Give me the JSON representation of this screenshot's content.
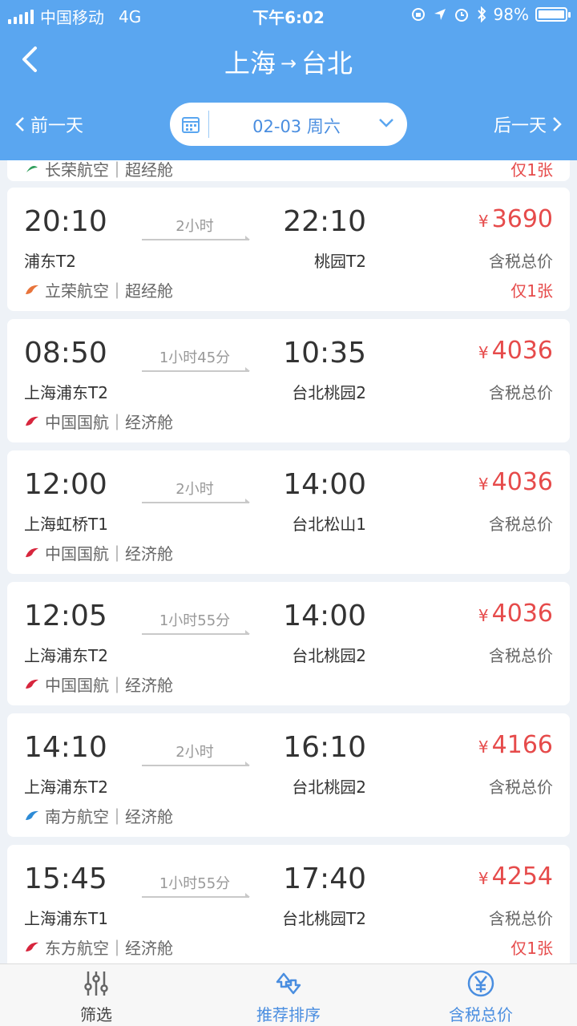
{
  "status_bar": {
    "carrier": "中国移动",
    "network": "4G",
    "time": "下午6:02",
    "battery": "98%"
  },
  "nav": {
    "origin": "上海",
    "arrow": "→",
    "destination": "台北"
  },
  "date_bar": {
    "prev_label": "前一天",
    "next_label": "后一天",
    "date": "02-03 周六"
  },
  "partial_card": {
    "airline": "长荣航空｜超经舱",
    "remaining": "仅1张"
  },
  "flights": [
    {
      "dep_time": "20:10",
      "duration": "2小时",
      "arr_time": "22:10",
      "dep_airport": "浦东T2",
      "arr_airport": "桃园T2",
      "airline": "立荣航空｜超经舱",
      "currency": "¥",
      "price": "3690",
      "price_label": "含税总价",
      "remaining": "仅1张",
      "logo_color": "#e8743b"
    },
    {
      "dep_time": "08:50",
      "duration": "1小时45分",
      "arr_time": "10:35",
      "dep_airport": "上海浦东T2",
      "arr_airport": "台北桃园2",
      "airline": "中国国航｜经济舱",
      "currency": "¥",
      "price": "4036",
      "price_label": "含税总价",
      "remaining": "",
      "logo_color": "#d7263d"
    },
    {
      "dep_time": "12:00",
      "duration": "2小时",
      "arr_time": "14:00",
      "dep_airport": "上海虹桥T1",
      "arr_airport": "台北松山1",
      "airline": "中国国航｜经济舱",
      "currency": "¥",
      "price": "4036",
      "price_label": "含税总价",
      "remaining": "",
      "logo_color": "#d7263d"
    },
    {
      "dep_time": "12:05",
      "duration": "1小时55分",
      "arr_time": "14:00",
      "dep_airport": "上海浦东T2",
      "arr_airport": "台北桃园2",
      "airline": "中国国航｜经济舱",
      "currency": "¥",
      "price": "4036",
      "price_label": "含税总价",
      "remaining": "",
      "logo_color": "#d7263d"
    },
    {
      "dep_time": "14:10",
      "duration": "2小时",
      "arr_time": "16:10",
      "dep_airport": "上海浦东T2",
      "arr_airport": "台北桃园2",
      "airline": "南方航空｜经济舱",
      "currency": "¥",
      "price": "4166",
      "price_label": "含税总价",
      "remaining": "",
      "logo_color": "#2d8bd6"
    },
    {
      "dep_time": "15:45",
      "duration": "1小时55分",
      "arr_time": "17:40",
      "dep_airport": "上海浦东T1",
      "arr_airport": "台北桃园T2",
      "airline": "东方航空｜经济舱",
      "currency": "¥",
      "price": "4254",
      "price_label": "含税总价",
      "remaining": "仅1张",
      "logo_color": "#d7263d"
    }
  ],
  "tabbar": {
    "filter": "筛选",
    "sort": "推荐排序",
    "total": "含税总价"
  },
  "colors": {
    "header": "#5aa6f0",
    "price": "#e64b4b",
    "tab_active": "#4a8ee0"
  }
}
